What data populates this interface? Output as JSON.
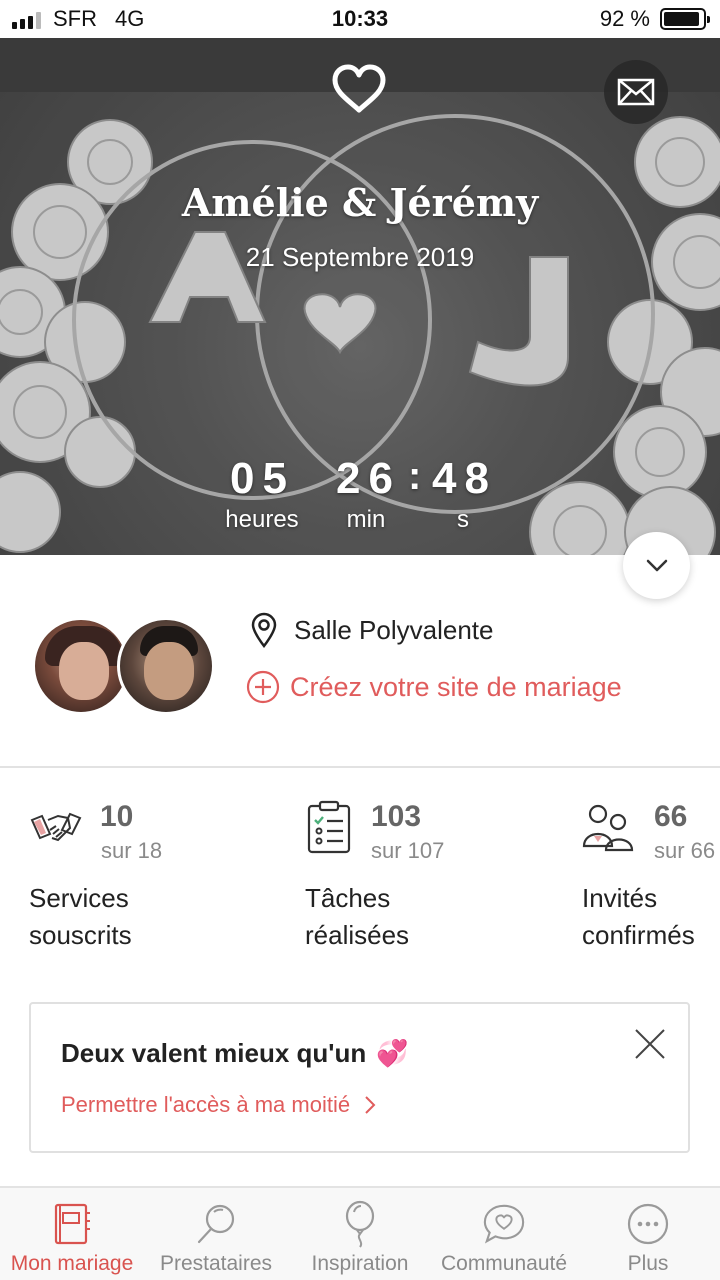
{
  "status_bar": {
    "carrier": "SFR",
    "network": "4G",
    "time": "10:33",
    "battery_percent": "92 %",
    "battery_level": 0.92,
    "signal_bars": 3
  },
  "hero": {
    "couple_names": "Amélie & Jérémy",
    "date": "21 Septembre 2019",
    "countdown": {
      "hours": "05",
      "minutes": "26",
      "separator": ":",
      "seconds": "48",
      "hours_label": "heures",
      "minutes_label": "min",
      "seconds_label": "s"
    }
  },
  "info": {
    "venue": "Salle Polyvalente",
    "create_site": "Créez votre site de mariage"
  },
  "stats": [
    {
      "value": "10",
      "sub": "sur 18",
      "label_line1": "Services",
      "label_line2": "souscrits",
      "icon": "handshake-icon"
    },
    {
      "value": "103",
      "sub": "sur 107",
      "label_line1": "Tâches",
      "label_line2": "réalisées",
      "icon": "checklist-icon"
    },
    {
      "value": "66",
      "sub": "sur 66",
      "label_line1": "Invités",
      "label_line2": "confirmés",
      "icon": "guests-icon"
    }
  ],
  "card": {
    "title": "Deux valent mieux qu'un",
    "emoji": "💞",
    "link": "Permettre l'accès à ma moitié"
  },
  "nav": {
    "items": [
      {
        "label": "Mon mariage",
        "icon": "notebook-icon",
        "active": true
      },
      {
        "label": "Prestataires",
        "icon": "magnifier-icon",
        "active": false
      },
      {
        "label": "Inspiration",
        "icon": "balloon-icon",
        "active": false
      },
      {
        "label": "Communauté",
        "icon": "chat-heart-icon",
        "active": false
      },
      {
        "label": "Plus",
        "icon": "more-icon",
        "active": false
      }
    ]
  },
  "colors": {
    "accent": "#e05c5c",
    "header": "#3a3a3a",
    "nav_active": "#d9534f"
  }
}
